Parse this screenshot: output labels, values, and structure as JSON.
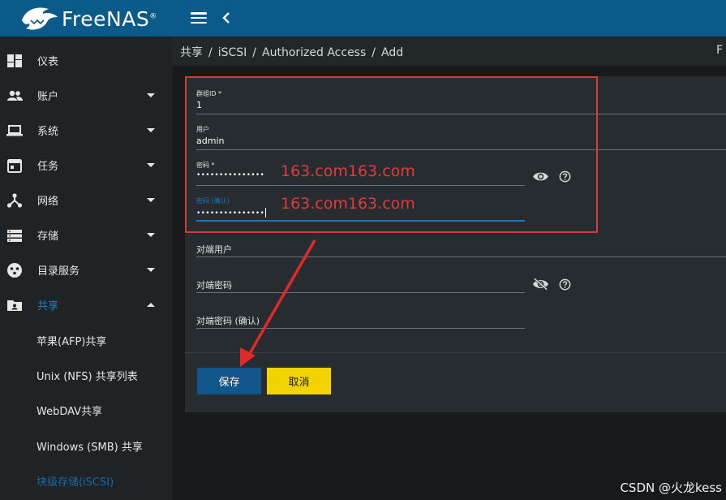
{
  "app": {
    "logo_text": "FreeNAS",
    "logo_mark": "®"
  },
  "breadcrumb": [
    "共享",
    "iSCSI",
    "Authorized Access",
    "Add"
  ],
  "breadcrumb_right": "F",
  "sidebar": {
    "items": [
      {
        "label": "仪表",
        "icon": "dashboard-icon",
        "expandable": false
      },
      {
        "label": "账户",
        "icon": "people-icon",
        "expandable": true
      },
      {
        "label": "系统",
        "icon": "laptop-icon",
        "expandable": true
      },
      {
        "label": "任务",
        "icon": "calendar-icon",
        "expandable": true
      },
      {
        "label": "网络",
        "icon": "network-icon",
        "expandable": true
      },
      {
        "label": "存储",
        "icon": "storage-icon",
        "expandable": true
      },
      {
        "label": "目录服务",
        "icon": "directory-icon",
        "expandable": true
      },
      {
        "label": "共享",
        "icon": "share-folder-icon",
        "expandable": true,
        "expanded": true,
        "active": true
      }
    ],
    "subitems": [
      {
        "label": "苹果(AFP)共享"
      },
      {
        "label": "Unix (NFS) 共享列表"
      },
      {
        "label": "WebDAV共享"
      },
      {
        "label": "Windows (SMB) 共享"
      },
      {
        "label": "块级存储(iSCSI)",
        "active": true
      }
    ]
  },
  "form": {
    "group_id": {
      "label": "群组ID *",
      "value": "1"
    },
    "user": {
      "label": "用户",
      "value": "admin"
    },
    "secret": {
      "label": "密码 *",
      "value": "•••••••••••••••"
    },
    "secret_confirm": {
      "label": "密码 (确认)",
      "value": "•••••••••••••••"
    },
    "peer_user": {
      "label": "对端用户",
      "value": ""
    },
    "peer_secret": {
      "label": "对端密码",
      "value": ""
    },
    "peer_secret_confirm": {
      "label": "对端密码 (确认)",
      "value": ""
    }
  },
  "annotations": {
    "overlay_1": "163.com163.com",
    "overlay_2": "163.com163.com"
  },
  "buttons": {
    "save": "保存",
    "cancel": "取消"
  },
  "watermark": "CSDN @火龙kess",
  "colors": {
    "topbar": "#0b5b8a",
    "accent": "#1a83c4",
    "save": "#10568a",
    "cancel": "#f2d403",
    "annotation": "#d63a3a"
  }
}
